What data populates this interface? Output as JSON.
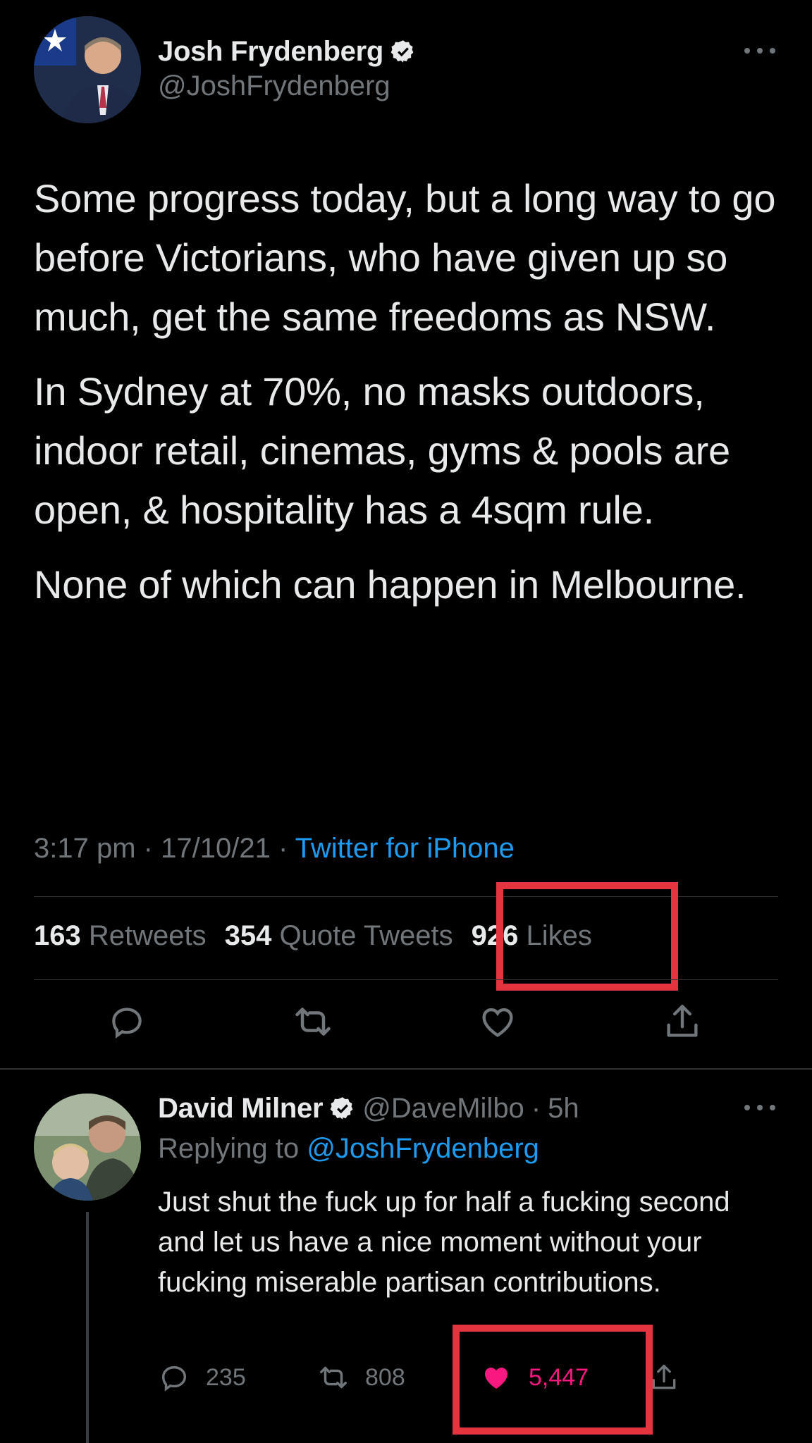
{
  "main_tweet": {
    "display_name": "Josh Frydenberg",
    "handle": "@JoshFrydenberg",
    "body": [
      "Some progress today, but a long way to go before Victorians, who have given up so much, get the same freedoms as NSW.",
      "In Sydney at 70%, no masks outdoors, indoor retail, cinemas, gyms & pools are open, & hospitality has a 4sqm rule.",
      "None of which can happen in Melbourne."
    ],
    "time": "3:17 pm",
    "date": "17/10/21",
    "separator": "·",
    "source": "Twitter for iPhone",
    "stats": {
      "retweets_count": "163",
      "retweets_label": "Retweets",
      "quote_count": "354",
      "quote_label": "Quote Tweets",
      "likes_count": "926",
      "likes_label": "Likes"
    }
  },
  "reply": {
    "display_name": "David Milner",
    "handle": "@DaveMilbo",
    "time": "5h",
    "separator": "·",
    "replying_prefix": "Replying to",
    "replying_handle": "@JoshFrydenberg",
    "body": "Just shut the fuck up for half a fucking second and let us have a nice moment without your fucking miserable partisan contributions.",
    "reply_count": "235",
    "retweet_count": "808",
    "like_count": "5,447"
  },
  "icons": {
    "verified": "verified-badge-icon",
    "more": "more-dots-icon",
    "reply": "speech-bubble-icon",
    "retweet": "retweet-arrows-icon",
    "like": "heart-icon",
    "share": "share-upload-icon"
  },
  "colors": {
    "background": "#000000",
    "text_primary": "#e7e9ea",
    "text_secondary": "#71767b",
    "link": "#1d9bf0",
    "like_pink": "#f91880",
    "highlight_red": "#e4343f"
  }
}
